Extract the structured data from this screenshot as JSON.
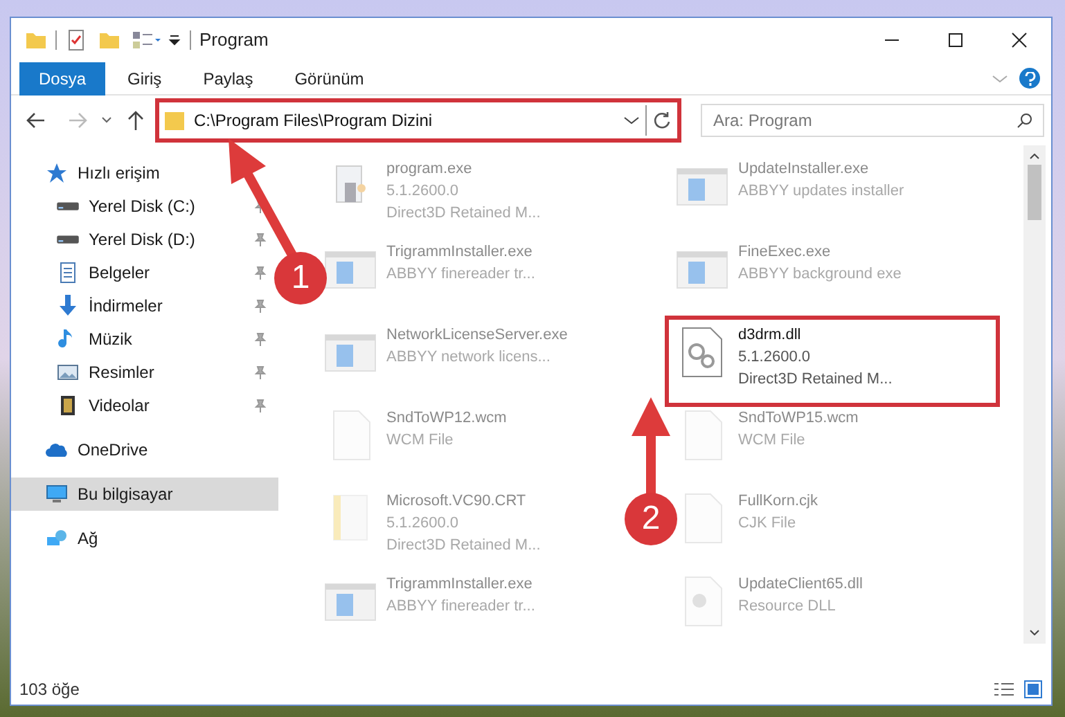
{
  "window": {
    "title": "Program"
  },
  "ribbon_tabs": [
    {
      "label": "Dosya",
      "selected": true
    },
    {
      "label": "Giriş",
      "selected": false
    },
    {
      "label": "Paylaş",
      "selected": false
    },
    {
      "label": "Görünüm",
      "selected": false
    }
  ],
  "address_bar": {
    "path": "C:\\Program Files\\Program Dizini",
    "highlighted": true
  },
  "search": {
    "placeholder": "Ara: Program"
  },
  "sidebar": {
    "items": [
      {
        "label": "Hızlı erişim",
        "kind": "star",
        "pinned": false,
        "selected": false,
        "children": [
          {
            "label": "Yerel Disk (C:)",
            "kind": "drive",
            "pinned": true,
            "selected": false
          },
          {
            "label": "Yerel Disk (D:)",
            "kind": "drive",
            "pinned": true,
            "selected": false
          },
          {
            "label": "Belgeler",
            "kind": "documents",
            "pinned": true,
            "selected": false
          },
          {
            "label": "İndirmeler",
            "kind": "downloads",
            "pinned": true,
            "selected": false
          },
          {
            "label": "Müzik",
            "kind": "music",
            "pinned": true,
            "selected": false
          },
          {
            "label": "Resimler",
            "kind": "pictures",
            "pinned": true,
            "selected": false
          },
          {
            "label": "Videolar",
            "kind": "videos",
            "pinned": true,
            "selected": false
          }
        ]
      },
      {
        "label": "OneDrive",
        "kind": "cloud",
        "pinned": false,
        "selected": false
      },
      {
        "label": "Bu bilgisayar",
        "kind": "computer",
        "pinned": false,
        "selected": true
      },
      {
        "label": "Ağ",
        "kind": "network",
        "pinned": false,
        "selected": false
      }
    ]
  },
  "files": [
    {
      "kind": "installer",
      "lines": [
        "program.exe",
        "5.1.2600.0",
        "Direct3D Retained M..."
      ],
      "blurred": true,
      "highlighted": false
    },
    {
      "kind": "app",
      "lines": [
        "UpdateInstaller.exe",
        "ABBYY updates installer"
      ],
      "blurred": true,
      "highlighted": false
    },
    {
      "kind": "app",
      "lines": [
        "TrigrammInstaller.exe",
        "ABBYY finereader tr..."
      ],
      "blurred": true,
      "highlighted": false
    },
    {
      "kind": "app",
      "lines": [
        "FineExec.exe",
        "ABBYY background exe"
      ],
      "blurred": true,
      "highlighted": false
    },
    {
      "kind": "app",
      "lines": [
        "NetworkLicenseServer.exe",
        "ABBYY network licens..."
      ],
      "blurred": true,
      "highlighted": false
    },
    {
      "kind": "dll",
      "lines": [
        "d3drm.dll",
        "5.1.2600.0",
        "Direct3D Retained M..."
      ],
      "blurred": false,
      "highlighted": true
    },
    {
      "kind": "document",
      "lines": [
        "SndToWP12.wcm",
        "WCM File"
      ],
      "blurred": true,
      "highlighted": false
    },
    {
      "kind": "document",
      "lines": [
        "SndToWP15.wcm",
        "WCM File"
      ],
      "blurred": true,
      "highlighted": false
    },
    {
      "kind": "folder",
      "lines": [
        "Microsoft.VC90.CRT",
        "5.1.2600.0",
        "Direct3D Retained M..."
      ],
      "blurred": true,
      "highlighted": false
    },
    {
      "kind": "document",
      "lines": [
        "FullKorn.cjk",
        "CJK File"
      ],
      "blurred": true,
      "highlighted": false
    },
    {
      "kind": "app",
      "lines": [
        "TrigrammInstaller.exe",
        "ABBYY finereader tr..."
      ],
      "blurred": true,
      "highlighted": false
    },
    {
      "kind": "resource",
      "lines": [
        "UpdateClient65.dll",
        "Resource DLL"
      ],
      "blurred": true,
      "highlighted": false
    }
  ],
  "status_bar": {
    "item_count": "103 öğe"
  },
  "annotations": [
    {
      "label": "1"
    },
    {
      "label": "2"
    }
  ]
}
